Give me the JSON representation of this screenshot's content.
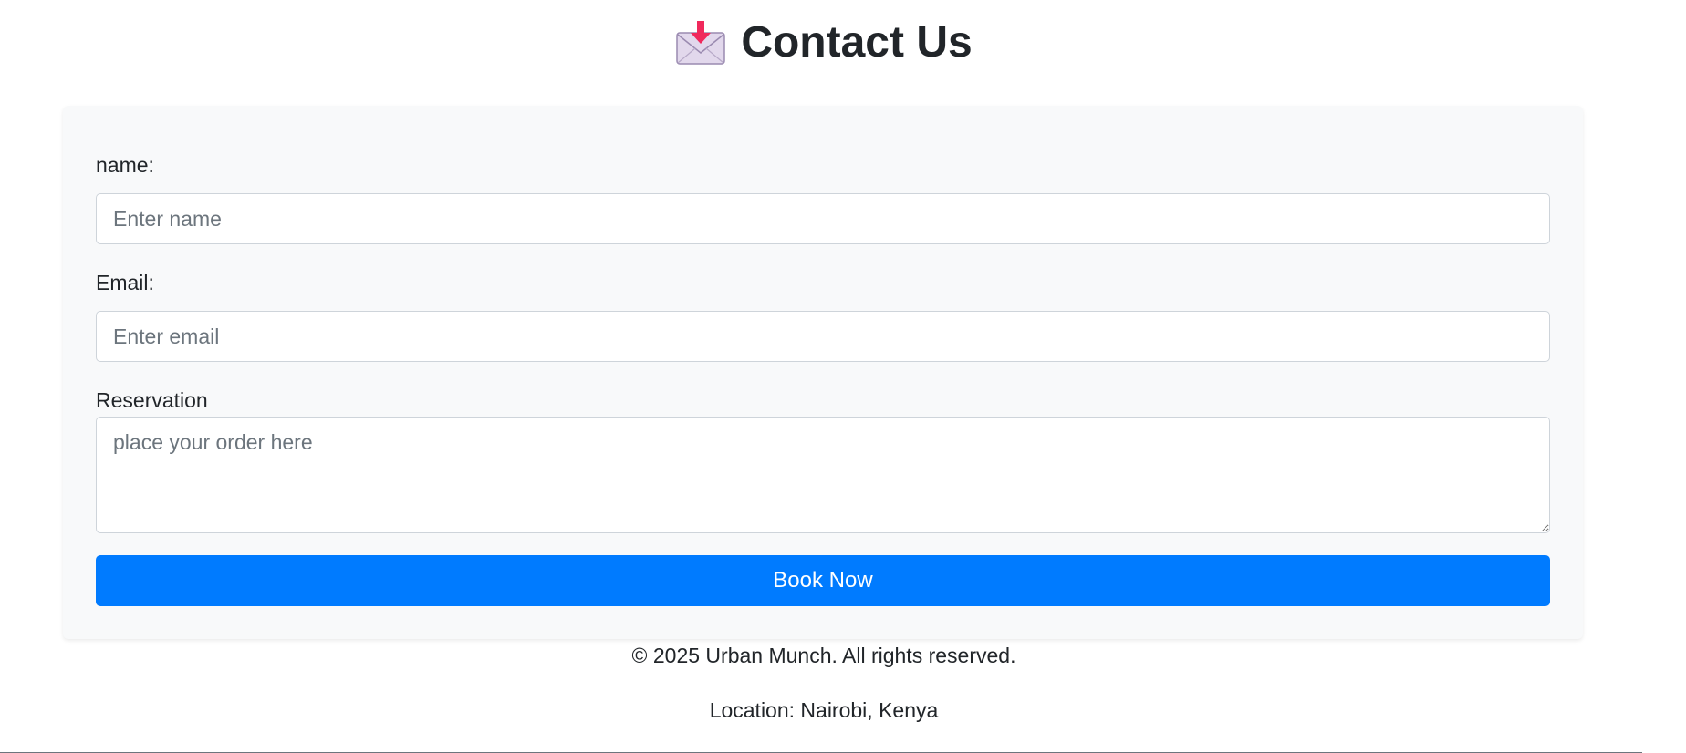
{
  "header": {
    "icon": "incoming-envelope-icon",
    "title": "Contact Us"
  },
  "form": {
    "name_label": "name:",
    "name_placeholder": "Enter name",
    "email_label": "Email:",
    "email_placeholder": "Enter email",
    "reservation_label": "Reservation",
    "reservation_placeholder": "place your order here",
    "submit_label": "Book Now"
  },
  "footer": {
    "copyright": "© 2025 Urban Munch. All rights reserved.",
    "location": "Location: Nairobi, Kenya"
  },
  "colors": {
    "primary": "#007bff",
    "card_background": "#f8f9fa",
    "icon_arrow": "#f0295c",
    "icon_envelope": "#e2d8ec"
  }
}
